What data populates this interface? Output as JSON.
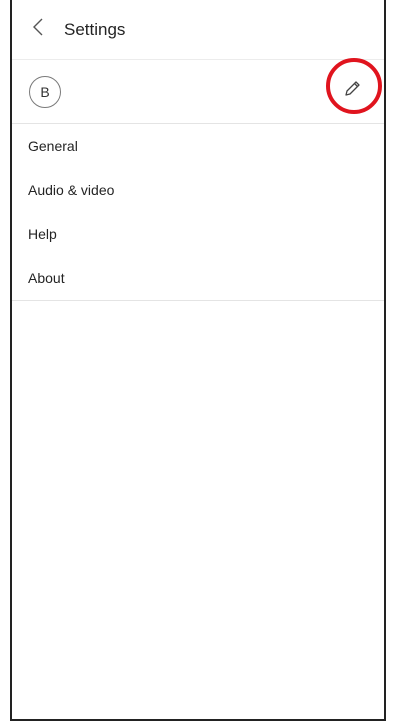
{
  "header": {
    "title": "Settings",
    "back_icon": "chevron-left-icon"
  },
  "profile": {
    "avatar_initial": "B",
    "edit_icon": "pencil-icon"
  },
  "menu": {
    "items": [
      {
        "label": "General"
      },
      {
        "label": "Audio & video"
      },
      {
        "label": "Help"
      },
      {
        "label": "About"
      }
    ]
  },
  "colors": {
    "highlight_ring": "#e0141e",
    "text": "#242424",
    "divider": "#e4e4e4"
  }
}
